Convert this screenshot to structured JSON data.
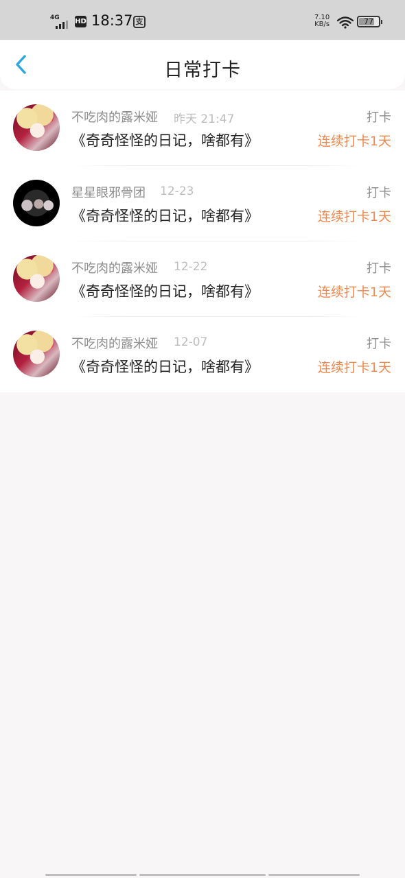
{
  "status_bar": {
    "network": "4G",
    "hd": "HD",
    "time": "18:37",
    "alipay_glyph": "支",
    "speed_value": "7.10",
    "speed_unit": "KB/s",
    "battery": "77",
    "battery_fraction": 0.77
  },
  "header": {
    "back_icon": "chevron-left-icon",
    "title": "日常打卡",
    "accent_color": "#2aa7e0"
  },
  "items": [
    {
      "name": "不吃肉的露米娅",
      "date": "昨天 21:47",
      "type": "打卡",
      "diary": "《奇奇怪怪的日记，啥都有》",
      "streak": "连续打卡1天",
      "avatar": "anime"
    },
    {
      "name": "星星眼邪骨团",
      "date": "12-23",
      "type": "打卡",
      "diary": "《奇奇怪怪的日记，啥都有》",
      "streak": "连续打卡1天",
      "avatar": "dark"
    },
    {
      "name": "不吃肉的露米娅",
      "date": "12-22",
      "type": "打卡",
      "diary": "《奇奇怪怪的日记，啥都有》",
      "streak": "连续打卡1天",
      "avatar": "anime"
    },
    {
      "name": "不吃肉的露米娅",
      "date": "12-07",
      "type": "打卡",
      "diary": "《奇奇怪怪的日记，啥都有》",
      "streak": "连续打卡1天",
      "avatar": "anime"
    }
  ],
  "colors": {
    "streak": "#f0884e",
    "background": "#f8f6f7"
  }
}
